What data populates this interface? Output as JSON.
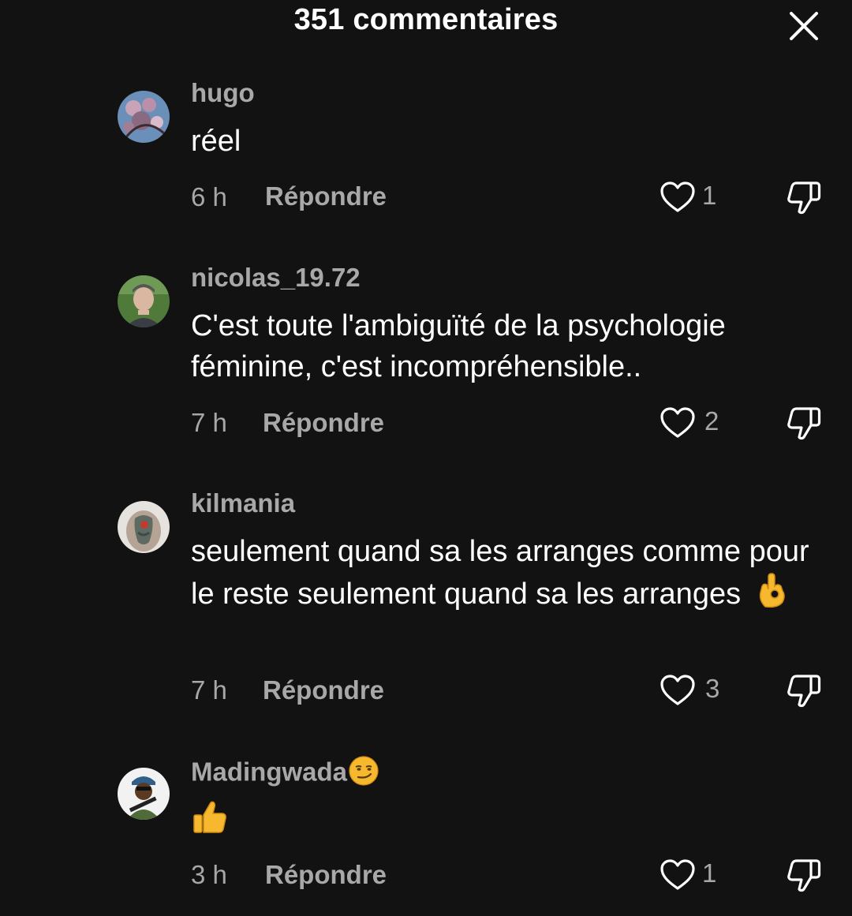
{
  "header": {
    "title": "351 commentaires",
    "close_icon": "close-icon"
  },
  "comments": [
    {
      "username": "hugo",
      "text": "réel",
      "time": "6 h",
      "reply_label": "Répondre",
      "likes": "1"
    },
    {
      "username": "nicolas_19.72",
      "text": "C'est toute l'ambiguïté de la psychologie féminine, c'est incompréhensible..",
      "time": "7 h",
      "reply_label": "Répondre",
      "likes": "2"
    },
    {
      "username": "kilmania",
      "text": "seulement quand sa les arranges comme pour le reste seulement quand sa les arranges",
      "text_emoji": "ok-hand-emoji",
      "time": "7 h",
      "reply_label": "Répondre",
      "likes": "3"
    },
    {
      "username": "Madingwada",
      "username_emoji": "smirking-face-emoji",
      "text": "",
      "text_emoji": "thumbs-up-emoji",
      "time": "3 h",
      "reply_label": "Répondre",
      "likes": "1"
    }
  ],
  "colors": {
    "background": "#121212",
    "primary_text": "#ffffff",
    "secondary_text": "#a8a8a8",
    "emoji_yellow": "#f5b82e"
  }
}
